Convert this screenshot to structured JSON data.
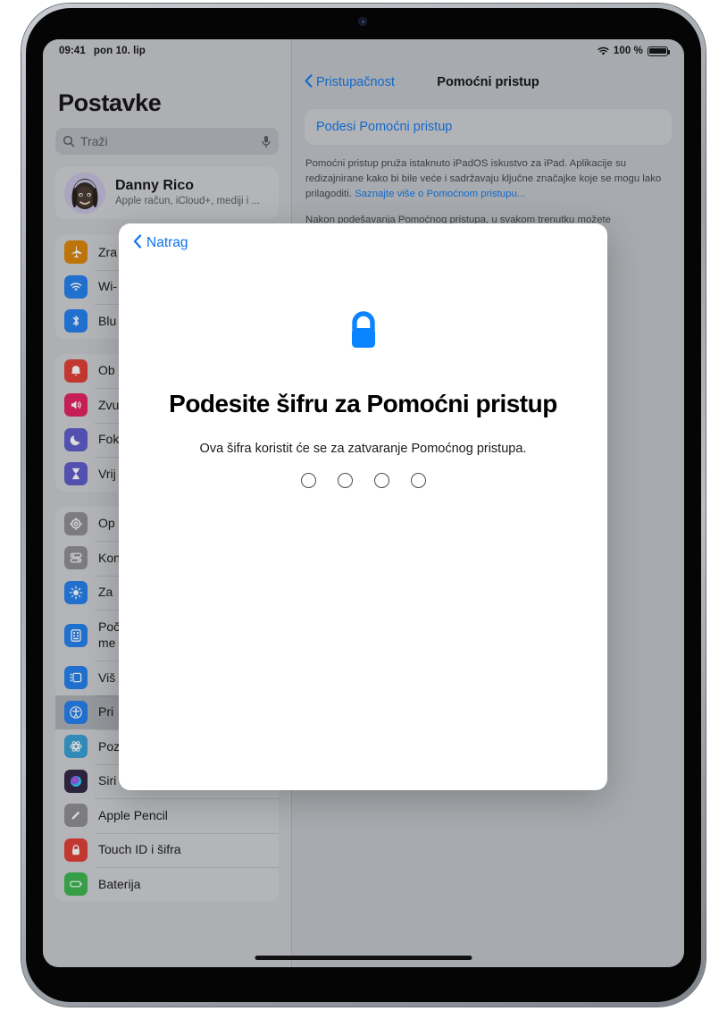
{
  "status_bar": {
    "time": "09:41",
    "date": "pon 10. lip",
    "wifi_icon": "wifi-icon",
    "battery_percent": "100 %",
    "battery_icon": "battery-icon"
  },
  "sidebar": {
    "title": "Postavke",
    "search": {
      "placeholder": "Traži",
      "value": "",
      "search_icon": "search-icon",
      "mic_icon": "microphone-icon"
    },
    "profile": {
      "name": "Danny Rico",
      "subtitle": "Apple račun, iCloud+, mediji i ...",
      "avatar_icon": "memoji-avatar"
    },
    "groups": [
      {
        "items": [
          {
            "label": "Zra",
            "icon": "airplane-icon",
            "color": "#d98200",
            "selected": false
          },
          {
            "label": "Wi-",
            "icon": "wifi-icon",
            "color": "#1c7ced",
            "selected": false
          },
          {
            "label": "Blu",
            "icon": "bluetooth-icon",
            "color": "#1c7ced",
            "selected": false
          }
        ]
      },
      {
        "items": [
          {
            "label": "Ob",
            "icon": "bell-icon",
            "color": "#e0372e",
            "selected": false
          },
          {
            "label": "Zvu",
            "icon": "speaker-icon",
            "color": "#e3195c",
            "selected": false
          },
          {
            "label": "Fok",
            "icon": "moon-icon",
            "color": "#5756c9",
            "selected": false
          },
          {
            "label": "Vrij",
            "icon": "hourglass-icon",
            "color": "#5756c9",
            "selected": false
          }
        ]
      },
      {
        "items": [
          {
            "label": "Op",
            "icon": "gear-icon",
            "color": "#8a8a8f",
            "selected": false
          },
          {
            "label": "Kon",
            "icon": "toggles-icon",
            "color": "#8a8a8f",
            "selected": false
          },
          {
            "label": "Za",
            "icon": "brightness-icon",
            "color": "#1c7ced",
            "selected": false
          },
          {
            "label": "Poč\nme",
            "icon": "home-screen-icon",
            "color": "#1c7ced",
            "selected": false,
            "tall": true
          },
          {
            "label": "Viš",
            "icon": "multitasking-icon",
            "color": "#1c7ced",
            "selected": false
          },
          {
            "label": "Pri",
            "icon": "accessibility-icon",
            "color": "#1c7ced",
            "selected": true
          },
          {
            "label": "Pozadina",
            "icon": "wallpaper-icon",
            "color": "#2f9bd4",
            "selected": false
          },
          {
            "label": "Siri i pretraživanje",
            "icon": "siri-icon",
            "color": "#2a1e3c",
            "selected": false
          },
          {
            "label": "Apple Pencil",
            "icon": "pencil-icon",
            "color": "#8a8a8f",
            "selected": false
          },
          {
            "label": "Touch ID i šifra",
            "icon": "lock-icon",
            "color": "#e0372e",
            "selected": false
          },
          {
            "label": "Baterija",
            "icon": "battery-icon",
            "color": "#35b44a",
            "selected": false
          }
        ]
      }
    ]
  },
  "detail": {
    "back_label": "Pristupačnost",
    "back_icon": "chevron-left-icon",
    "title": "Pomoćni pristup",
    "setup_link": "Podesi Pomoćni pristup",
    "paragraph_1_before": "Pomoćni pristup pruža istaknuto iPadOS iskustvo za iPad. Aplikacije su redizajnirane kako bi bile veće i sadržavaju ključne značajke koje se mogu lako prilagoditi. ",
    "paragraph_1_link": "Saznajte više o Pomoćnom pristupu...",
    "paragraph_2": "Nakon podešavanja Pomoćnog pristupa, u svakom trenutku možete"
  },
  "modal": {
    "back_label": "Natrag",
    "back_icon": "chevron-left-icon",
    "lock_icon": "lock-icon",
    "title": "Podesite šifru za Pomoćni pristup",
    "subtitle": "Ova šifra koristit će se za zatvaranje Pomoćnog pristupa.",
    "passcode_length": 4,
    "passcode_filled": 0
  },
  "home_indicator": "home-indicator",
  "colors": {
    "accent_blue": "#0a74ec",
    "lock_blue": "#0a84ff",
    "screen_bg": "#bfc2c7",
    "sidebar_bg": "#c6c9cd",
    "card_bg": "#cdd0d4",
    "selected_row": "#a9acb1"
  }
}
